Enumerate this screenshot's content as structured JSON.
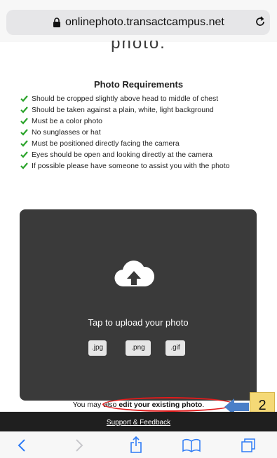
{
  "browser": {
    "url": "onlinephoto.transactcampus.net",
    "partial_top_text": "(partially visible)"
  },
  "heading_cutoff": "photo.",
  "requirements": {
    "title": "Photo Requirements",
    "items": [
      "Should be cropped slightly above head to middle of chest",
      "Should be taken against a plain, white, light background",
      "Must be a color photo",
      "No sunglasses or hat",
      "Must be positioned directly facing the camera",
      "Eyes should be open and looking directly at the camera",
      "If possible please have someone to assist you with the photo"
    ]
  },
  "upload": {
    "prompt": "Tap to upload your photo",
    "file_types": [
      ".jpg",
      ".png",
      ".gif"
    ]
  },
  "edit_line": {
    "prefix": "You may also ",
    "link": "edit your existing photo",
    "suffix": "."
  },
  "annotation": {
    "step_number": "2",
    "highlight_color": "#e21b1b",
    "arrow_color": "#4a7fc8",
    "badge_color": "#f5d976"
  },
  "footer": {
    "support_link": "Support & Feedback"
  },
  "colors": {
    "check_green": "#2aa32a",
    "panel_bg": "#3a3a3a",
    "footer_bg": "#1f1f1f"
  },
  "icons": {
    "lock": "lock-icon",
    "reload": "reload-icon",
    "upload": "cloud-upload-icon",
    "back": "back-icon",
    "forward": "forward-icon",
    "share": "share-icon",
    "bookmarks": "bookmarks-icon",
    "tabs": "tabs-icon"
  }
}
